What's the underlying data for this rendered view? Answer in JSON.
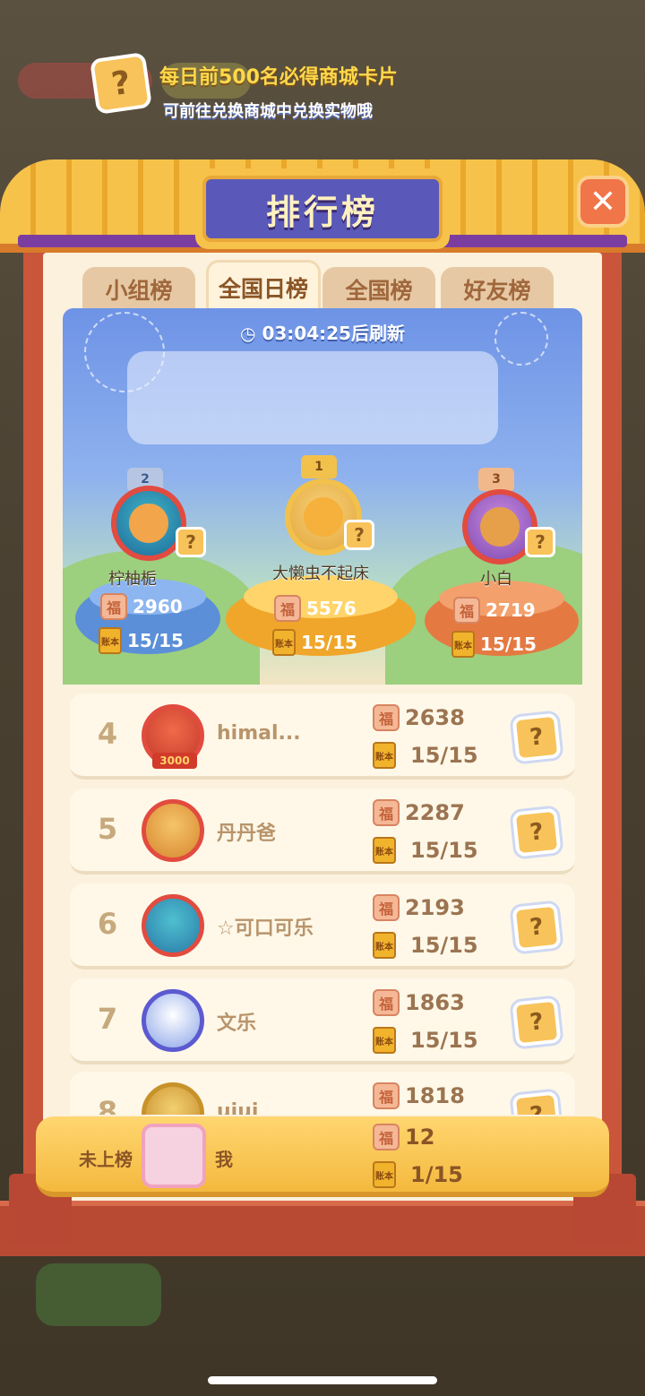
{
  "colors": {
    "frame": "#c9553a",
    "roof": "#f6c24a",
    "title_plate": "#5a59b9",
    "accent_gold": "#f4b93e"
  },
  "title": "排行榜",
  "close_label": "✕",
  "tabs": [
    {
      "label": "小组榜",
      "active": false
    },
    {
      "label": "全国日榜",
      "active": true
    },
    {
      "label": "全国榜",
      "active": false
    },
    {
      "label": "好友榜",
      "active": false
    }
  ],
  "countdown": {
    "time": "03:04:25",
    "suffix": "后刷新"
  },
  "banner": {
    "line1": "每日前500名必得商城卡片",
    "line2": "可前往兑换商城中兑换实物哦",
    "card_glyph": "?"
  },
  "podium": [
    {
      "rank": "2",
      "name": "柠柚栀",
      "score": "2960",
      "progress": "15/15"
    },
    {
      "rank": "1",
      "name": "大懒虫不起床",
      "score": "5576",
      "progress": "15/15"
    },
    {
      "rank": "3",
      "name": "小白",
      "score": "2719",
      "progress": "15/15"
    }
  ],
  "icons": {
    "coin": "福",
    "book": "账本",
    "card": "?"
  },
  "rows": [
    {
      "rank": "4",
      "name": "himal...",
      "score": "2638",
      "progress": "15/15",
      "avatar_badge": "3000"
    },
    {
      "rank": "5",
      "name": "丹丹爸",
      "score": "2287",
      "progress": "15/15"
    },
    {
      "rank": "6",
      "name": "☆可口可乐",
      "score": "2193",
      "progress": "15/15"
    },
    {
      "rank": "7",
      "name": "文乐",
      "score": "1863",
      "progress": "15/15"
    },
    {
      "rank": "8",
      "name": "uiui",
      "score": "1818",
      "progress": ""
    }
  ],
  "me": {
    "status": "未上榜",
    "name": "我",
    "score": "12",
    "progress": "1/15"
  }
}
